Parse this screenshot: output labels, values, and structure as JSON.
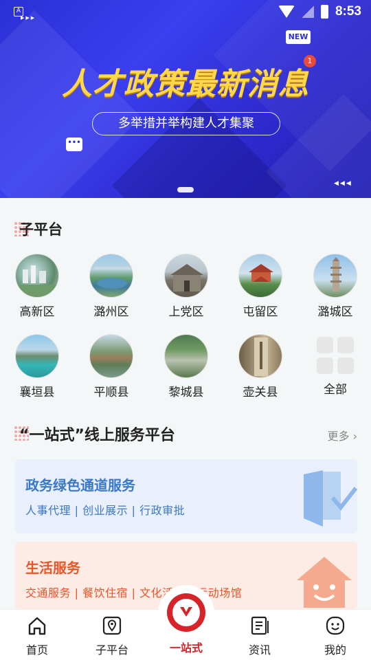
{
  "status_bar": {
    "time": "8:53",
    "app_indicator": "A"
  },
  "banner": {
    "badge": "NEW",
    "notification_count": "1",
    "title": "人才政策最新消息",
    "subtitle": "多举措并举构建人才集聚",
    "chat_icon": "•••"
  },
  "sub_platform": {
    "title": "子平台",
    "items": [
      {
        "label": "高新区"
      },
      {
        "label": "潞州区"
      },
      {
        "label": "上党区"
      },
      {
        "label": "屯留区"
      },
      {
        "label": "潞城区"
      },
      {
        "label": "襄垣县"
      },
      {
        "label": "平顺县"
      },
      {
        "label": "黎城县"
      },
      {
        "label": "壶关县"
      },
      {
        "label": "全部"
      }
    ]
  },
  "one_stop": {
    "title": "“一站式”线上服务平台",
    "more": "更多",
    "cards": [
      {
        "title": "政务绿色通道服务",
        "desc": "人事代理 | 创业展示 | 行政审批",
        "accent": "#3a78c8",
        "bg": "#eaf0fb"
      },
      {
        "title": "生活服务",
        "desc": "交通服务 | 餐饮住宿 | 文化活动 | 运动场馆",
        "accent": "#e8562a",
        "bg": "#fdebe5"
      }
    ]
  },
  "nav": {
    "items": [
      {
        "label": "首页"
      },
      {
        "label": "子平台"
      },
      {
        "label": "一站式"
      },
      {
        "label": "资讯"
      },
      {
        "label": "我的"
      }
    ]
  }
}
